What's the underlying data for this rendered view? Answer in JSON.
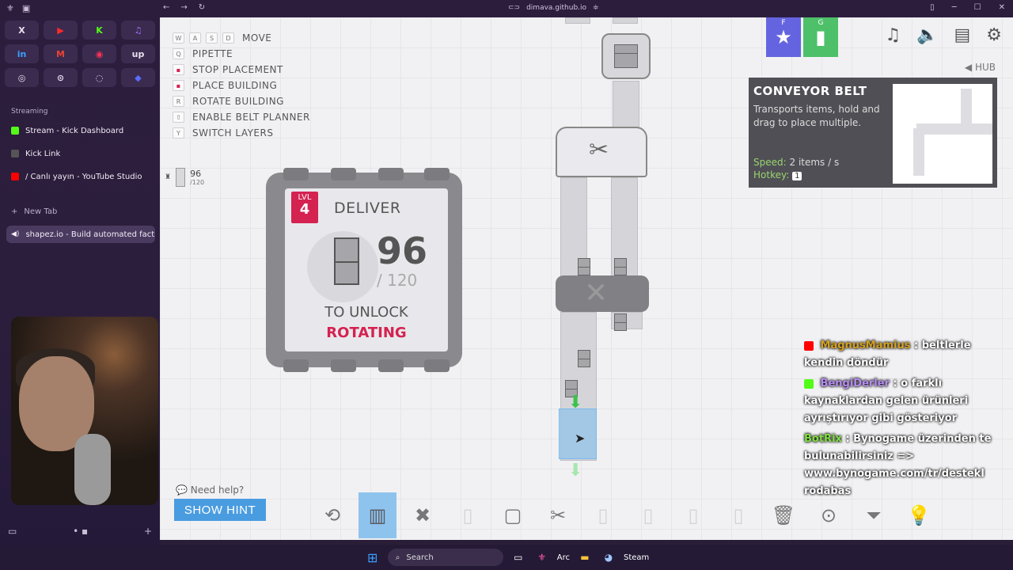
{
  "browser": {
    "url": "dimava.github.io",
    "favorites": [
      "X",
      "▶",
      "K",
      "♫",
      "in",
      "M",
      "◉",
      "up",
      "◎",
      "⊙",
      "◌",
      "◆"
    ],
    "section": "Streaming",
    "tabs": [
      {
        "label": "Stream - Kick Dashboard",
        "color": "#53fc18"
      },
      {
        "label": "Kick Link",
        "color": "#555555"
      },
      {
        "label": "/ Canlı yayın - YouTube Studio",
        "color": "#ff0000"
      }
    ],
    "new_tab": "New Tab",
    "active_tab": "shapez.io - Build automated fact..."
  },
  "keybindings": [
    {
      "keys": [
        "W",
        "A",
        "S",
        "D"
      ],
      "label": "MOVE"
    },
    {
      "keys": [
        "Q"
      ],
      "label": "PIPETTE"
    },
    {
      "keys": [
        "▪"
      ],
      "label": "STOP PLACEMENT"
    },
    {
      "keys": [
        "▪"
      ],
      "label": "PLACE BUILDING"
    },
    {
      "keys": [
        "R"
      ],
      "label": "ROTATE BUILDING"
    },
    {
      "keys": [
        "⇧"
      ],
      "label": "ENABLE BELT PLANNER"
    },
    {
      "keys": [
        "Y"
      ],
      "label": "SWITCH LAYERS"
    }
  ],
  "hub_counter": {
    "value": "96",
    "max": "/120"
  },
  "hub": {
    "level_label": "LVL",
    "level": "4",
    "deliver": "DELIVER",
    "count": "96",
    "required": "/ 120",
    "to_unlock": "TO UNLOCK",
    "reward": "ROTATING"
  },
  "top_right": {
    "star_key": "F",
    "stats_key": "G",
    "hub_link": "◀ HUB"
  },
  "building_panel": {
    "title": "CONVEYOR BELT",
    "description": "Transports items, hold and drag to place multiple.",
    "speed_label": "Speed:",
    "speed_value": "2 items / s",
    "hotkey_label": "Hotkey:",
    "hotkey_value": "1"
  },
  "chat": [
    {
      "user": "MagnusMamius",
      "msg": ": beltlerle kendin döndür"
    },
    {
      "user": "BengiDerler",
      "msg": ": o farklı kaynaklardan gelen ürünleri ayrıştırıyor gibi gösteriyor"
    },
    {
      "user": "BotRix",
      "msg": ": Bynogame üzerinden te bulunabilirsiniz => www.bynogame.com/tr/destekl rodabas"
    }
  ],
  "help": {
    "question": "Need help?",
    "button": "SHOW HINT"
  },
  "taskbar": {
    "search": "Search",
    "arc": "Arc",
    "steam": "Steam"
  }
}
